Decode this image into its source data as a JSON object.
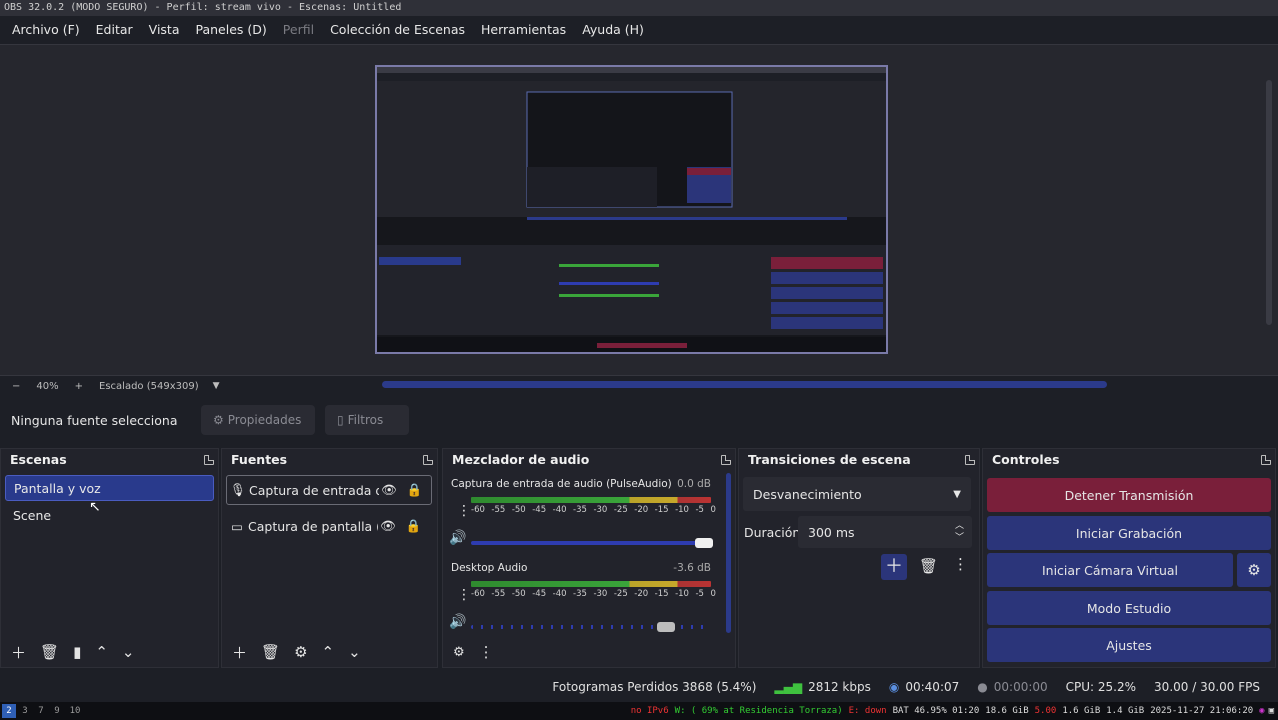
{
  "window": {
    "title": "OBS 32.0.2 (MODO SEGURO) - Perfil: stream vivo - Escenas: Untitled"
  },
  "menu": [
    {
      "label": "Archivo (F)",
      "disabled": false
    },
    {
      "label": "Editar",
      "disabled": false
    },
    {
      "label": "Vista",
      "disabled": false
    },
    {
      "label": "Paneles (D)",
      "disabled": false
    },
    {
      "label": "Perfil",
      "disabled": true
    },
    {
      "label": "Colección de Escenas",
      "disabled": false
    },
    {
      "label": "Herramientas",
      "disabled": false
    },
    {
      "label": "Ayuda (H)",
      "disabled": false
    }
  ],
  "preview": {
    "zoom_minus": "−",
    "zoom_level": "40%",
    "zoom_plus": "+",
    "scale_label": "Escalado (549x309)"
  },
  "source_toolbar": {
    "no_source": "Ninguna fuente selecciona",
    "properties": "Propiedades",
    "filters": "Filtros"
  },
  "scenes": {
    "title": "Escenas",
    "items": [
      {
        "label": "Pantalla y voz",
        "selected": true
      },
      {
        "label": "Scene",
        "selected": false
      }
    ]
  },
  "sources": {
    "title": "Fuentes",
    "items": [
      {
        "label": "Captura de entrada d",
        "icon": "microphone-icon"
      },
      {
        "label": "Captura de pantalla (",
        "icon": "monitor-icon"
      }
    ]
  },
  "mixer": {
    "title": "Mezclador de audio",
    "tick_labels": [
      "-60",
      "-55",
      "-50",
      "-45",
      "-40",
      "-35",
      "-30",
      "-25",
      "-20",
      "-15",
      "-10",
      "-5",
      "0"
    ],
    "channels": [
      {
        "name": "Captura de entrada de audio (PulseAudio)",
        "db": "0.0 dB",
        "volume": 1.0
      },
      {
        "name": "Desktop Audio",
        "db": "-3.6 dB",
        "volume": 0.8
      }
    ]
  },
  "transitions": {
    "title": "Transiciones de escena",
    "selected": "Desvanecimiento",
    "duration_label": "Duración",
    "duration_value": "300 ms"
  },
  "controls": {
    "title": "Controles",
    "stop_streaming": "Detener Transmisión",
    "start_recording": "Iniciar Grabación",
    "start_virtualcam": "Iniciar Cámara Virtual",
    "studio_mode": "Modo Estudio",
    "settings": "Ajustes",
    "colors": {
      "stop": "#7a1f3a",
      "normal": "#2b357a"
    }
  },
  "status": {
    "dropped_frames": "Fotogramas Perdidos 3868 (5.4%)",
    "bitrate": "2812 kbps",
    "stream_time": "00:40:07",
    "record_time": "00:00:00",
    "cpu": "CPU: 25.2%",
    "fps": "30.00 / 30.00 FPS"
  },
  "taskbar": {
    "workspaces": [
      "2",
      "3",
      "7",
      "9",
      "10"
    ],
    "active_workspace": "2",
    "ipv6": "no IPv6",
    "wifi": "W: ( 69% at Residencia Torraza)",
    "eth": "E: down",
    "battery": "BAT 46.95% 01:20",
    "disk": "18.6 GiB",
    "load": "5.00",
    "mem1": "1.6 GiB",
    "mem2": "1.4 GiB",
    "datetime": "2025-11-27 21:06:20"
  }
}
